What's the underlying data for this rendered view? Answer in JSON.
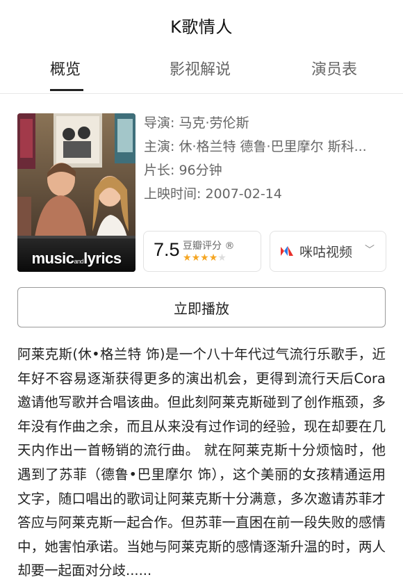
{
  "header": {
    "title": "K歌情人"
  },
  "tabs": [
    {
      "label": "概览",
      "active": true
    },
    {
      "label": "影视解说",
      "active": false
    },
    {
      "label": "演员表",
      "active": false
    }
  ],
  "poster": {
    "wordmark": "music and lyrics"
  },
  "info": {
    "director": "导演: 马克·劳伦斯",
    "cast": "主演: 休·格兰特 德鲁·巴里摩尔 斯科...",
    "runtime": "片长: 96分钟",
    "release": "上映时间: 2007-02-14"
  },
  "rating": {
    "score": "7.5",
    "label": "豆瓣评分",
    "mark": "®",
    "stars": 4
  },
  "provider": {
    "name": "咪咕视频",
    "icon": "migu-logo-icon"
  },
  "play_button": "立即播放",
  "synopsis": "阿莱克斯(休•格兰特 饰)是一个八十年代过气流行乐歌手，近年好不容易逐渐获得更多的演出机会，更得到流行天后Cora邀请他写歌并合唱该曲。但此刻阿莱克斯碰到了创作瓶颈，多年没有作曲之余，而且从来没有过作词的经验，现在却要在几天内作出一首畅销的流行曲。 就在阿莱克斯十分烦恼时，他遇到了苏菲（德鲁•巴里摩尔 饰），这个美丽的女孩精通运用文字，随口唱出的歌词让阿莱克斯十分满意，多次邀请苏菲才答应与阿莱克斯一起合作。但苏菲一直困在前一段失败的感情中，她害怕承诺。当她与阿莱克斯的感情逐渐升温的时，两人却要一起面对分歧......",
  "colors": {
    "star": "#f5a623",
    "star_empty": "#dcdcdc",
    "migu_red": "#e8302b",
    "migu_blue": "#2b7be8"
  }
}
